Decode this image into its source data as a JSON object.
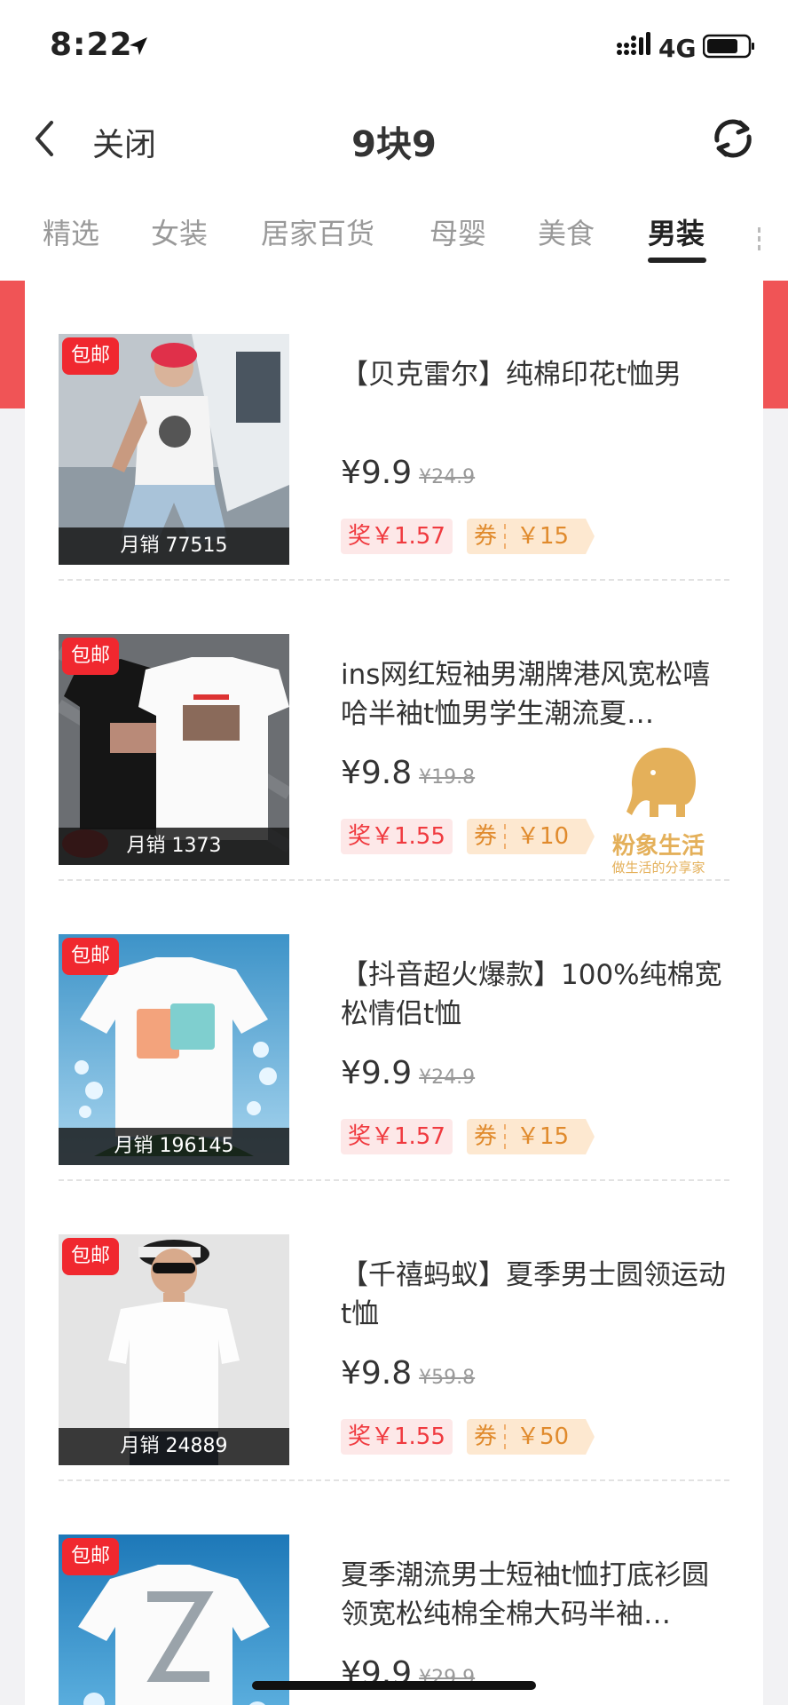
{
  "status_bar": {
    "time": "8:22",
    "network": "4G"
  },
  "nav": {
    "close_label": "关闭",
    "title": "9块9"
  },
  "tabs": [
    {
      "label": "精选"
    },
    {
      "label": "女装"
    },
    {
      "label": "居家百货"
    },
    {
      "label": "母婴"
    },
    {
      "label": "美食"
    },
    {
      "label": "男装",
      "active": true
    }
  ],
  "common": {
    "free_shipping": "包邮",
    "reward_prefix": "奖",
    "coupon_prefix": "券"
  },
  "products": [
    {
      "title": "【贝克雷尔】纯棉印花t恤男",
      "price": "¥9.9",
      "original_price": "¥24.9",
      "sales": "月销 77515",
      "reward": "奖￥1.57",
      "coupon": "￥15"
    },
    {
      "title": "ins网红短袖男潮牌港风宽松嘻哈半袖t恤男学生潮流夏…",
      "price": "¥9.8",
      "original_price": "¥19.8",
      "sales": "月销 1373",
      "reward": "奖￥1.55",
      "coupon": "￥10"
    },
    {
      "title": "【抖音超火爆款】100%纯棉宽松情侣t恤",
      "price": "¥9.9",
      "original_price": "¥24.9",
      "sales": "月销 196145",
      "reward": "奖￥1.57",
      "coupon": "￥15"
    },
    {
      "title": "【千禧蚂蚁】夏季男士圆领运动t恤",
      "price": "¥9.8",
      "original_price": "¥59.8",
      "sales": "月销 24889",
      "reward": "奖￥1.55",
      "coupon": "￥50"
    },
    {
      "title": "夏季潮流男士短袖t恤打底衫圆领宽松纯棉全棉大码半袖…",
      "price": "¥9.9",
      "original_price": "¥29.9"
    }
  ],
  "watermark": {
    "name": "粉象生活",
    "slogan": "做生活的分享家"
  },
  "colors": {
    "accent_red": "#f0282f",
    "coupon_orange": "#e08a2c",
    "watermark_gold": "#e4b05a"
  }
}
